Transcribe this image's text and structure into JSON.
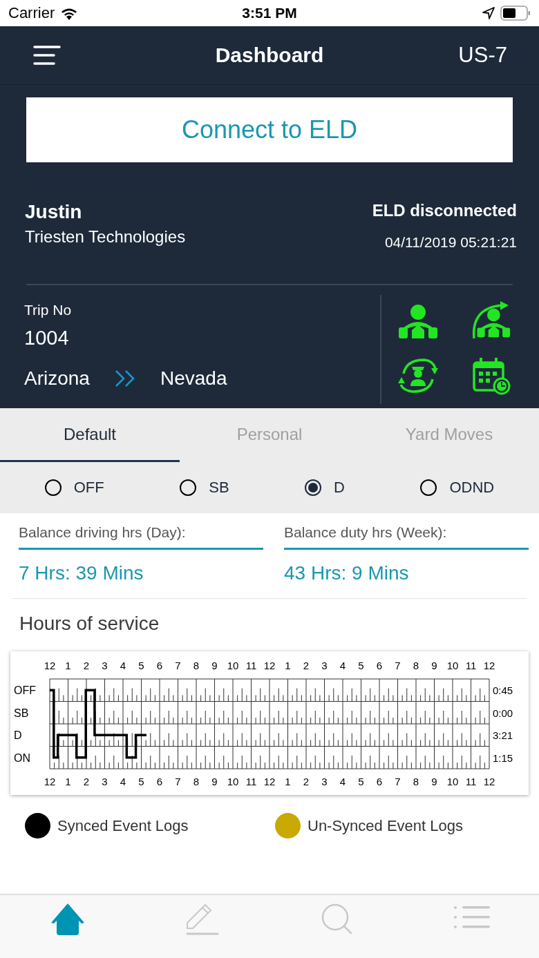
{
  "status_bar": {
    "carrier": "Carrier",
    "time": "3:51 PM"
  },
  "header": {
    "title": "Dashboard",
    "unit": "US-7"
  },
  "connect_button": "Connect to ELD",
  "driver": {
    "name": "Justin",
    "company": "Triesten Technologies",
    "eld_status": "ELD disconnected",
    "timestamp": "04/11/2019 05:21:21"
  },
  "trip": {
    "label": "Trip No",
    "number": "1004",
    "from": "Arizona",
    "to": "Nevada"
  },
  "tabs": [
    {
      "label": "Default",
      "selected": true
    },
    {
      "label": "Personal",
      "selected": false
    },
    {
      "label": "Yard Moves",
      "selected": false
    }
  ],
  "duty_status": [
    {
      "label": "OFF",
      "selected": false
    },
    {
      "label": "SB",
      "selected": false
    },
    {
      "label": "D",
      "selected": true
    },
    {
      "label": "ODND",
      "selected": false
    }
  ],
  "balances": [
    {
      "label": "Balance driving hrs (Day):",
      "value": "7 Hrs: 39 Mins"
    },
    {
      "label": "Balance duty hrs (Week):",
      "value": "43 Hrs: 9 Mins"
    }
  ],
  "hours_of_service": {
    "title": "Hours of service",
    "top_labels": [
      "12",
      "1",
      "2",
      "3",
      "4",
      "5",
      "6",
      "7",
      "8",
      "9",
      "10",
      "11",
      "12",
      "1",
      "2",
      "3",
      "4",
      "5",
      "6",
      "7",
      "8",
      "9",
      "10",
      "11",
      "12"
    ],
    "bottom_labels": [
      "12",
      "1",
      "2",
      "3",
      "4",
      "5",
      "6",
      "7",
      "8",
      "9",
      "10",
      "11",
      "12",
      "1",
      "2",
      "3",
      "4",
      "5",
      "6",
      "7",
      "8",
      "9",
      "10",
      "11",
      "12"
    ],
    "rows": [
      {
        "label": "OFF",
        "total": "0:45"
      },
      {
        "label": "SB",
        "total": "0:00"
      },
      {
        "label": "D",
        "total": "3:21"
      },
      {
        "label": "ON",
        "total": "1:15"
      }
    ]
  },
  "legend": [
    {
      "label": "Synced Event Logs",
      "color": "#000000"
    },
    {
      "label": "Un-Synced Event Logs",
      "color": "#c9a800"
    }
  ],
  "tab_bar": [
    {
      "kind": "home",
      "selected": true
    },
    {
      "kind": "edit",
      "selected": false
    },
    {
      "kind": "search",
      "selected": false
    },
    {
      "kind": "list",
      "selected": false
    }
  ]
}
